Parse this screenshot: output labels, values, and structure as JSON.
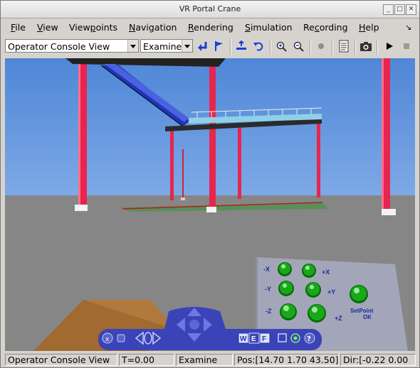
{
  "window": {
    "title": "VR Portal Crane"
  },
  "menu": [
    {
      "label": "File",
      "mnemonic": "F",
      "rest": "ile"
    },
    {
      "label": "View",
      "mnemonic": "V",
      "rest": "iew"
    },
    {
      "label": "Viewpoints",
      "pre": "View",
      "mnemonic": "p",
      "rest": "oints"
    },
    {
      "label": "Navigation",
      "mnemonic": "N",
      "rest": "avigation"
    },
    {
      "label": "Rendering",
      "mnemonic": "R",
      "rest": "endering"
    },
    {
      "label": "Simulation",
      "mnemonic": "S",
      "rest": "imulation"
    },
    {
      "label": "Recording",
      "pre": "Re",
      "mnemonic": "c",
      "rest": "ording"
    },
    {
      "label": "Help",
      "mnemonic": "H",
      "rest": "elp"
    }
  ],
  "toolbar": {
    "viewpoint_selected": "Operator Console View",
    "navigation_mode": "Examine"
  },
  "scene": {
    "panel_labels": [
      "-X",
      "+X",
      "-Y",
      "+Y",
      "-Z",
      "+Z"
    ],
    "setpoint_label_1": "SetPoint",
    "setpoint_label_2": "OK",
    "navpanel_w": "W",
    "navpanel_e": "E",
    "navpanel_f": "F",
    "navpanel_help": "?"
  },
  "status": {
    "viewpoint": "Operator Console View",
    "time": "T=0.00",
    "mode": "Examine",
    "position": "Pos:[14.70 1.70 43.50]",
    "direction": "Dir:[-0.22 0.00"
  },
  "colors": {
    "sky": "#5a8fd8",
    "ground": "#8a8a8a",
    "pillar": "#e8254f",
    "bridge": "#1f35b8",
    "button_green": "#18a818",
    "navbar": "#3a44b8"
  }
}
